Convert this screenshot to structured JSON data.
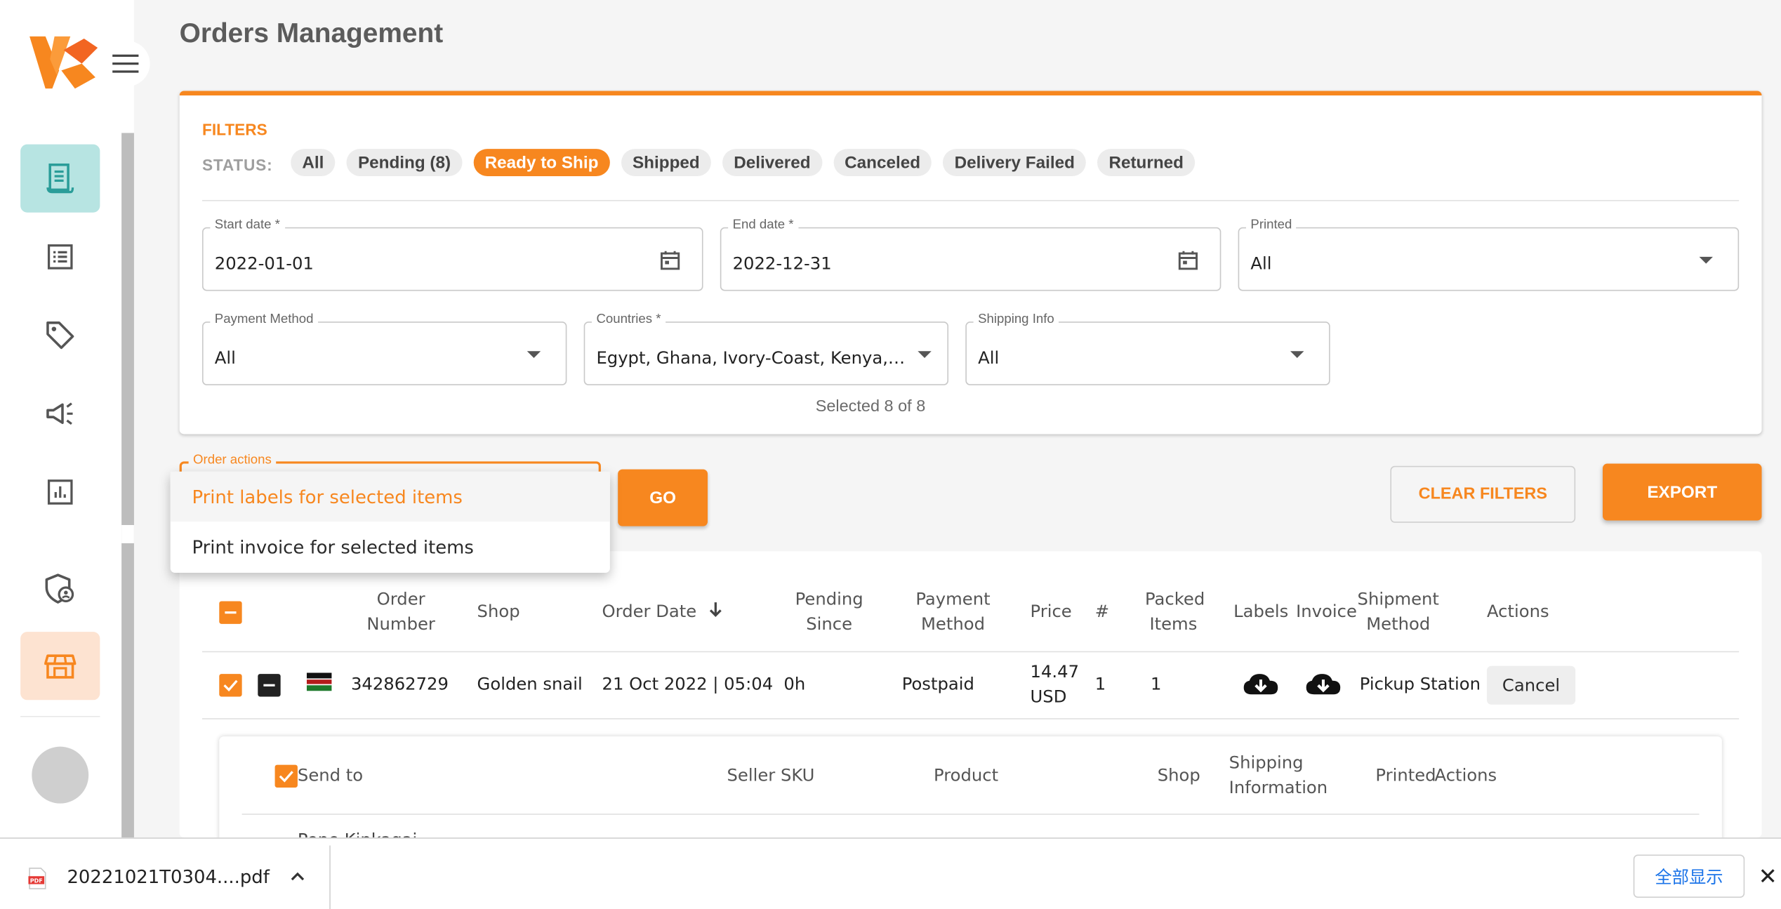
{
  "page": {
    "title": "Orders Management"
  },
  "sidebar": {
    "items": [
      {
        "icon": "orders-receipt-icon"
      },
      {
        "icon": "list-icon"
      },
      {
        "icon": "tag-icon"
      },
      {
        "icon": "megaphone-icon"
      },
      {
        "icon": "analytics-icon"
      },
      {
        "icon": "shield-user-icon"
      },
      {
        "icon": "store-icon"
      }
    ]
  },
  "filters": {
    "title": "FILTERS",
    "status_label": "STATUS:",
    "statuses": [
      "All",
      "Pending (8)",
      "Ready to Ship",
      "Shipped",
      "Delivered",
      "Canceled",
      "Delivery Failed",
      "Returned"
    ],
    "active_status": "Ready to Ship",
    "start_date": {
      "label": "Start date *",
      "value": "2022-01-01"
    },
    "end_date": {
      "label": "End date *",
      "value": "2022-12-31"
    },
    "printed": {
      "label": "Printed",
      "value": "All"
    },
    "payment_method": {
      "label": "Payment Method",
      "value": "All"
    },
    "countries": {
      "label": "Countries *",
      "value": "Egypt, Ghana, Ivory-Coast, Kenya, M...",
      "note": "Selected 8 of 8"
    },
    "shipping_info": {
      "label": "Shipping Info",
      "value": "All"
    }
  },
  "order_actions": {
    "label": "Order actions",
    "options": [
      "Print labels for selected items",
      "Print invoice for selected items"
    ],
    "go": "GO"
  },
  "buttons": {
    "clear_filters": "CLEAR FILTERS",
    "export": "EXPORT"
  },
  "table": {
    "headers": {
      "order_number": "Order\nNumber",
      "shop": "Shop",
      "order_date": "Order Date",
      "pending_since": "Pending\nSince",
      "payment_method": "Payment\nMethod",
      "price": "Price",
      "count": "#",
      "packed_items": "Packed\nItems",
      "labels": "Labels",
      "invoice": "Invoice",
      "shipment_method": "Shipment\nMethod",
      "actions": "Actions"
    },
    "rows": [
      {
        "order_number": "342862729",
        "shop": "Golden snail",
        "order_date": "21 Oct 2022 | 05:04",
        "pending_since": "0h",
        "payment_method": "Postpaid",
        "price": "14.47\nUSD",
        "count": "1",
        "packed_items": "1",
        "shipment_method": "Pickup Station",
        "action": "Cancel"
      }
    ],
    "sub_headers": {
      "send_to": "Send to",
      "seller_sku": "Seller SKU",
      "product": "Product",
      "shop": "Shop",
      "shipping_information": "Shipping\nInformation",
      "printed": "Printed",
      "actions": "Actions"
    },
    "sub_first_cell": "Pepe Kipkagai"
  },
  "downloads": {
    "file": "20221021T0304....pdf",
    "show_all": "全部显示"
  },
  "colors": {
    "accent": "#f7871f",
    "teal": "#2a9d99"
  }
}
